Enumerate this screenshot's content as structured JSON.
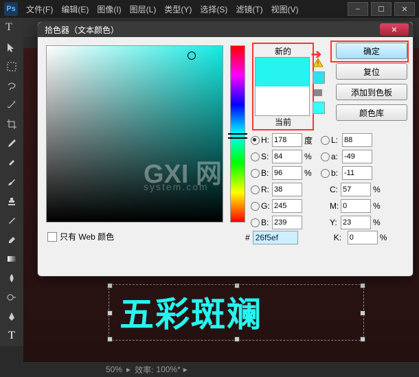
{
  "menubar": {
    "items": [
      "文件(F)",
      "编辑(E)",
      "图像(I)",
      "图层(L)",
      "类型(Y)",
      "选择(S)",
      "滤镜(T)",
      "视图(V)"
    ]
  },
  "options_bar": {
    "tool_char": "T"
  },
  "canvas": {
    "text": "五彩斑斓"
  },
  "statusbar": {
    "zoom": "50%",
    "efficiency_label": "效率:",
    "efficiency_value": "100%*"
  },
  "dialog": {
    "title": "拾色器（文本颜色）",
    "new_label": "新的",
    "current_label": "当前",
    "buttons": {
      "ok": "确定",
      "cancel": "复位",
      "add_swatch": "添加到色板",
      "color_libraries": "颜色库"
    },
    "hsb": {
      "H": "178",
      "S": "84",
      "B": "96"
    },
    "rgb": {
      "R": "38",
      "G": "245",
      "B_": "239"
    },
    "lab": {
      "L": "88",
      "a": "-49",
      "b": "-11"
    },
    "cmyk": {
      "C": "57",
      "M": "0",
      "Y": "23",
      "K": "0"
    },
    "units": {
      "deg": "度",
      "pct": "%"
    },
    "hex_prefix": "#",
    "hex": "26f5ef",
    "web_only_label": "只有 Web 颜色"
  },
  "watermark": {
    "big": "GXI 网",
    "small": "system.com"
  }
}
